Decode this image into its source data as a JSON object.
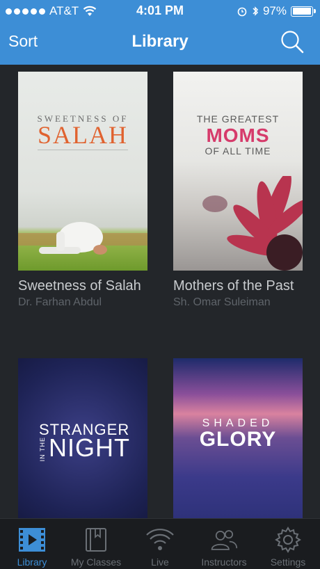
{
  "status_bar": {
    "carrier": "AT&T",
    "time": "4:01 PM",
    "battery_percent": "97%",
    "battery_level": 0.97
  },
  "nav": {
    "sort_label": "Sort",
    "title": "Library",
    "search_icon": "search-icon"
  },
  "covers": {
    "salah": {
      "line1": "SWEETNESS OF",
      "line2": "SALAH"
    },
    "moms": {
      "line1": "THE GREATEST",
      "line2": "MOMS",
      "line3": "OF ALL TIME"
    },
    "night": {
      "line1": "STRANGER",
      "line2": "IN THE",
      "line3": "NIGHT"
    },
    "glory": {
      "line1": "SHADED",
      "line2": "GLORY"
    }
  },
  "library": {
    "items": [
      {
        "title": "Sweetness of Salah",
        "author": "Dr. Farhan Abdul"
      },
      {
        "title": "Mothers of the Past",
        "author": "Sh. Omar Suleiman"
      },
      {
        "title": "",
        "author": ""
      },
      {
        "title": "",
        "author": ""
      }
    ]
  },
  "tabbar": {
    "accent": "#3d8ed6",
    "tabs": [
      {
        "label": "Library",
        "icon": "film-icon",
        "active": true
      },
      {
        "label": "My Classes",
        "icon": "book-icon",
        "active": false
      },
      {
        "label": "Live",
        "icon": "broadcast-icon",
        "active": false
      },
      {
        "label": "Instructors",
        "icon": "people-icon",
        "active": false
      },
      {
        "label": "Settings",
        "icon": "gear-icon",
        "active": false
      }
    ]
  }
}
